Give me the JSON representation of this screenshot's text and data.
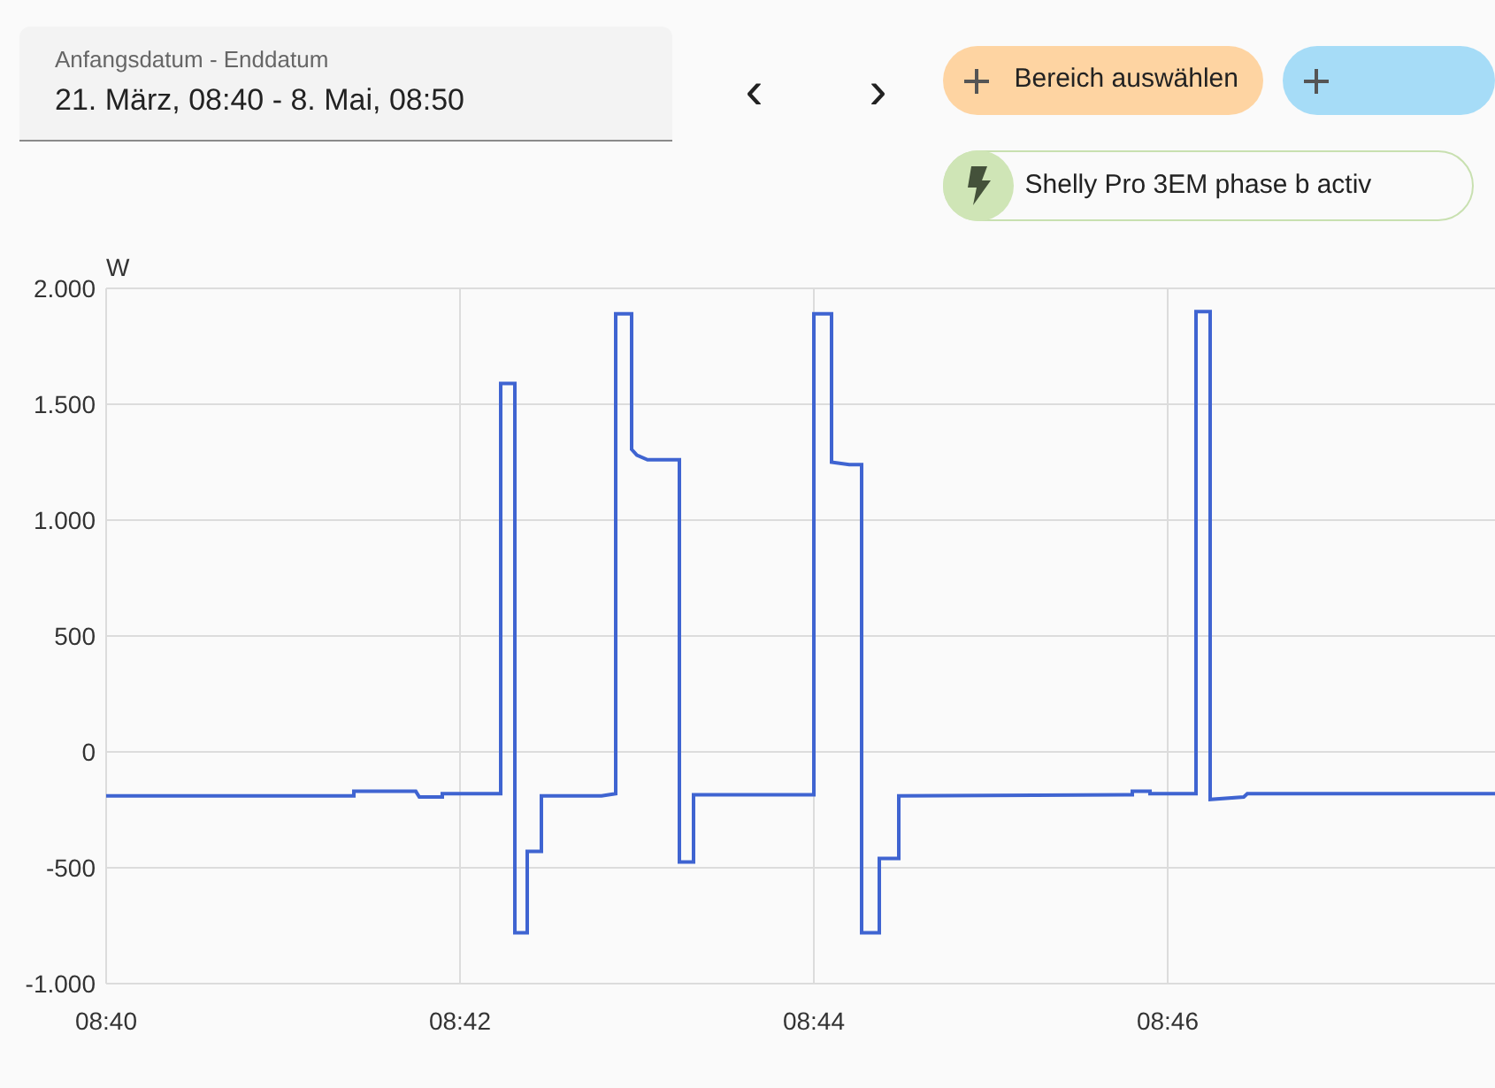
{
  "date_range": {
    "label": "Anfangsdatum - Enddatum",
    "value": "21. März, 08:40 - 8. Mai, 08:50"
  },
  "nav": {
    "previous": "‹",
    "next": "›"
  },
  "actions": [
    {
      "kind": "add",
      "label": "Bereich auswählen",
      "color": "#fed4a2"
    },
    {
      "kind": "add",
      "color": "#a6dcf7"
    }
  ],
  "entity_chip": {
    "label": "Shelly Pro 3EM phase b activ"
  },
  "chart": {
    "chart_data": {
      "type": "line",
      "grid": true,
      "ylabel": "W",
      "xlim": [
        520,
        527.85
      ],
      "ylim": [
        -1000,
        2000
      ],
      "xticks": [
        {
          "value": 520,
          "label": "08:40"
        },
        {
          "value": 522,
          "label": "08:42"
        },
        {
          "value": 524,
          "label": "08:44"
        },
        {
          "value": 526,
          "label": "08:46"
        }
      ],
      "yticks": [
        {
          "value": 2000,
          "label": "2.000"
        },
        {
          "value": 1500,
          "label": "1.500"
        },
        {
          "value": 1000,
          "label": "1.000"
        },
        {
          "value": 500,
          "label": "500"
        },
        {
          "value": 0,
          "label": "0"
        },
        {
          "value": -500,
          "label": "-500"
        },
        {
          "value": -1000,
          "label": "-1.000"
        }
      ],
      "x": [
        520,
        521.4,
        521.4,
        521.75,
        521.77,
        521.9,
        521.9,
        522.23,
        522.23,
        522.31,
        522.31,
        522.38,
        522.38,
        522.46,
        522.46,
        522.8,
        522.88,
        522.88,
        522.97,
        522.97,
        523.0,
        523.06,
        523.24,
        523.24,
        523.32,
        523.32,
        524.0,
        524.0,
        524.1,
        524.1,
        524.2,
        524.27,
        524.27,
        524.37,
        524.37,
        524.48,
        524.48,
        525.8,
        525.8,
        525.9,
        525.9,
        526.16,
        526.16,
        526.24,
        526.24,
        526.43,
        526.45,
        527.85
      ],
      "series": [
        {
          "color": "#3f64d1",
          "values": [
            -190,
            -190,
            -170,
            -170,
            -195,
            -195,
            -180,
            -180,
            1590,
            1590,
            -780,
            -780,
            -430,
            -430,
            -190,
            -190,
            -180,
            1890,
            1890,
            1305,
            1280,
            1260,
            1260,
            -475,
            -475,
            -185,
            -185,
            1890,
            1890,
            1250,
            1240,
            1240,
            -780,
            -780,
            -460,
            -460,
            -190,
            -185,
            -170,
            -170,
            -180,
            -180,
            1900,
            1900,
            -205,
            -195,
            -180,
            -180
          ]
        }
      ]
    }
  }
}
